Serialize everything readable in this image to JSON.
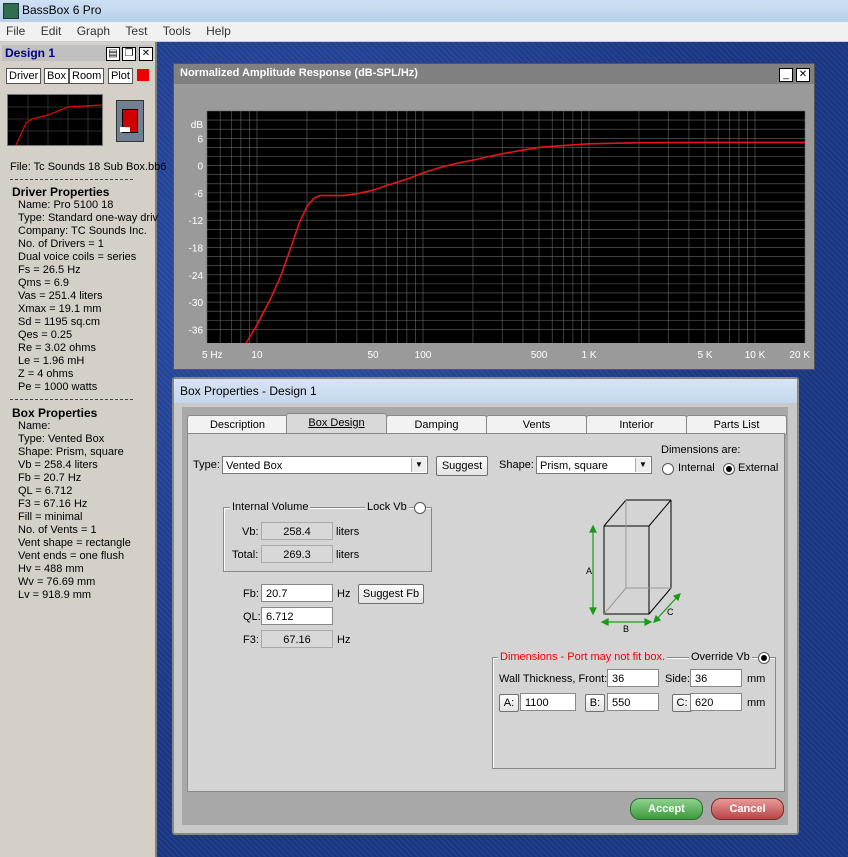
{
  "app": {
    "title": "BassBox 6 Pro"
  },
  "menu": [
    "File",
    "Edit",
    "Graph",
    "Test",
    "Tools",
    "Help"
  ],
  "design_panel": {
    "title": "Design 1",
    "buttons": [
      "Driver",
      "Box",
      "Room",
      "Plot"
    ],
    "file": "File: Tc Sounds 18 Sub Box.bb6",
    "driver_heading": "Driver Properties",
    "driver_props": [
      "Name: Pro 5100 18",
      "Type: Standard one-way driv",
      "Company: TC Sounds Inc.",
      "No. of Drivers = 1",
      "Dual voice coils = series",
      "Fs =  26.5 Hz",
      "Qms =  6.9",
      "Vas =  251.4 liters",
      "Xmax =  19.1 mm",
      "Sd =  1195 sq.cm",
      "Qes =  0.25",
      "Re =  3.02 ohms",
      "Le =  1.96 mH",
      "Z =  4 ohms",
      "Pe =  1000 watts"
    ],
    "box_heading": "Box Properties",
    "box_props": [
      "Name:",
      "Type: Vented Box",
      "Shape: Prism, square",
      "Vb =  258.4 liters",
      "Fb =  20.7 Hz",
      "QL =  6.712",
      "F3 =  67.16 Hz",
      "Fill = minimal",
      "No. of Vents = 1",
      "Vent shape = rectangle",
      "Vent ends = one flush",
      "Hv =  488 mm",
      "Wv =  76.69 mm",
      "Lv =  918.9 mm"
    ]
  },
  "plot_window": {
    "title": "Normalized Amplitude Response (dB-SPL/Hz)"
  },
  "chart_data": {
    "type": "line",
    "title": "Normalized Amplitude Response (dB-SPL/Hz)",
    "ylabel": "dB",
    "xscale": "log",
    "xlim": [
      5,
      20000
    ],
    "ylim": [
      -39,
      12
    ],
    "yticks": [
      6,
      0,
      -6,
      -12,
      -18,
      -24,
      -30,
      -36
    ],
    "xtick_labels": [
      {
        "v": 5,
        "t": "5 Hz"
      },
      {
        "v": 10,
        "t": "10"
      },
      {
        "v": 50,
        "t": "50"
      },
      {
        "v": 100,
        "t": "100"
      },
      {
        "v": 500,
        "t": "500"
      },
      {
        "v": 1000,
        "t": "1 K"
      },
      {
        "v": 5000,
        "t": "5 K"
      },
      {
        "v": 10000,
        "t": "10 K"
      },
      {
        "v": 20000,
        "t": "20 K"
      }
    ],
    "series": [
      {
        "color": "#e8141c",
        "x": [
          8.6,
          10,
          12,
          14,
          16,
          18,
          20,
          22,
          24,
          28,
          33,
          40,
          50,
          60,
          80,
          100,
          130,
          160,
          200,
          250,
          300,
          400,
          500,
          700,
          1000,
          2000,
          5000,
          10000,
          20000
        ],
        "y": [
          -39,
          -35,
          -29.5,
          -24,
          -18,
          -12.5,
          -9,
          -7.2,
          -6.6,
          -6.6,
          -6.6,
          -6.2,
          -5.4,
          -4.4,
          -3.0,
          -1.6,
          -0.3,
          0.5,
          1.2,
          2.0,
          2.6,
          3.4,
          4.0,
          4.4,
          4.8,
          5.0,
          5.1,
          5.1,
          5.1
        ]
      }
    ]
  },
  "dialog": {
    "title": "Box Properties - Design 1",
    "tabs": [
      "Description",
      "Box Design",
      "Damping",
      "Vents",
      "Interior",
      "Parts List"
    ],
    "type_label": "Type:",
    "type_value": "Vented Box",
    "suggest_label": "Suggest",
    "shape_label": "Shape:",
    "shape_value": "Prism, square",
    "dims_are": "Dimensions are:",
    "internal": "Internal",
    "external": "External",
    "internal_volume": "Internal Volume",
    "lock_vb": "Lock Vb",
    "vb_label": "Vb:",
    "vb_value": "258.4",
    "vb_unit": "liters",
    "total_label": "Total:",
    "total_value": "269.3",
    "total_unit": "liters",
    "fb_label": "Fb:",
    "fb_value": "20.7",
    "fb_unit": "Hz",
    "suggest_fb": "Suggest Fb",
    "ql_label": "QL:",
    "ql_value": "6.712",
    "f3_label": "F3:",
    "f3_value": "67.16",
    "f3_unit": "Hz",
    "dims_warning": "Dimensions - Port may not fit box.",
    "override_vb": "Override Vb",
    "wall_label": "Wall Thickness, Front:",
    "wall_front": "36",
    "side_label": "Side:",
    "side_value": "36",
    "mm": "mm",
    "a_label": "A:",
    "a_value": "1100",
    "b_label": "B:",
    "b_value": "550",
    "c_label": "C:",
    "c_value": "620",
    "box_a": "A",
    "box_b": "B",
    "box_c": "C",
    "accept": "Accept",
    "cancel": "Cancel"
  }
}
